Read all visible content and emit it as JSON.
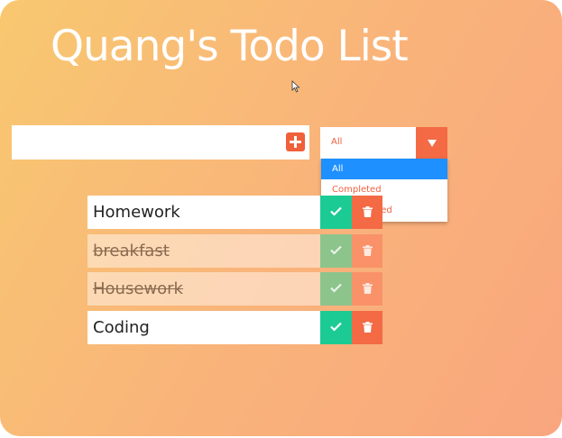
{
  "app": {
    "title": "Quang's Todo List"
  },
  "input": {
    "value": ""
  },
  "filter": {
    "selected": "All",
    "options": [
      "All",
      "Completed",
      "Uncompleted"
    ]
  },
  "todos": [
    {
      "text": "Homework",
      "completed": false
    },
    {
      "text": "breakfast",
      "completed": true
    },
    {
      "text": "Housework",
      "completed": true
    },
    {
      "text": "Coding",
      "completed": false
    }
  ],
  "icons": {
    "add": "plus-square-icon",
    "dropdown": "caret-down-icon",
    "check": "check-icon",
    "trash": "trash-icon"
  },
  "colors": {
    "accent": "#f36a45",
    "complete": "#1ccb93",
    "selected_option": "#1e90ff"
  }
}
